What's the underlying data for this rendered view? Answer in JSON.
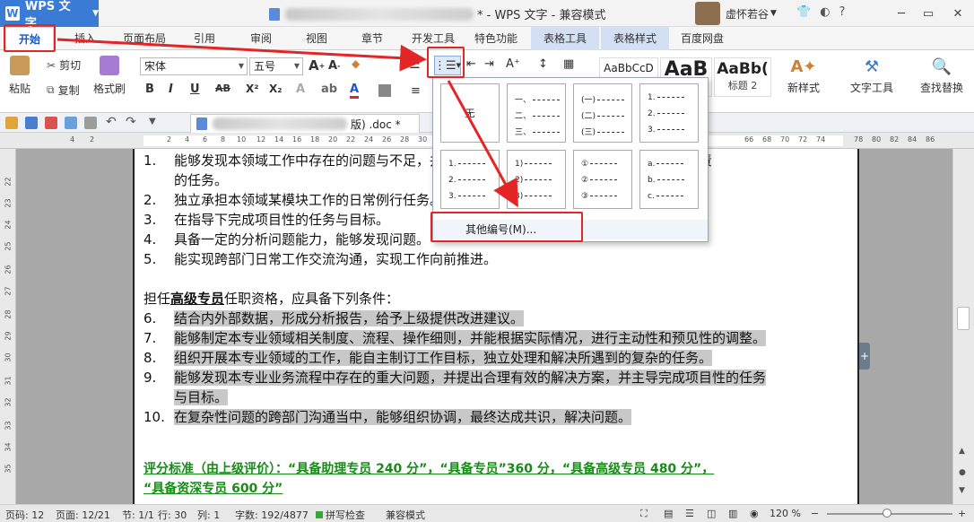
{
  "titlebar": {
    "app_button": "WPS 文字",
    "title": "* - WPS 文字 - 兼容模式",
    "user": "虚怀若谷"
  },
  "tabs": [
    "开始",
    "插入",
    "页面布局",
    "引用",
    "审阅",
    "视图",
    "章节",
    "开发工具",
    "特色功能",
    "表格工具",
    "表格样式",
    "百度网盘"
  ],
  "ribbon": {
    "paste": "粘贴",
    "cut": "剪切",
    "copy": "复制",
    "format_painter": "格式刷",
    "font_name": "宋体",
    "font_size": "五号",
    "style_normal": "AaBbCcD",
    "style_h1": "AaB",
    "style_h2": "AaBb(",
    "style_h2_label": "标题 2",
    "new_style": "新样式",
    "text_tools": "文字工具",
    "find_replace": "查找替换"
  },
  "quickbar": {
    "doc_tab": "版) .doc *"
  },
  "numbering_menu": {
    "none_label": "无",
    "styles": [
      [
        "一、",
        "二、",
        "三、"
      ],
      [
        "(一)",
        "(二)",
        "(三)"
      ],
      [
        "1.",
        "2.",
        "3."
      ],
      [
        "1.",
        "2.",
        "3."
      ],
      [
        "1)",
        "2)",
        "3)"
      ],
      [
        "①",
        "②",
        "③"
      ],
      [
        "a.",
        "b.",
        "c."
      ]
    ],
    "more": "其他编号(M)..."
  },
  "document": {
    "lines": [
      {
        "num": "1.",
        "text": "能够发现本领域工作中存在的问题与不足，并能针对性地提出改进建议，处理和解决所负责",
        "hl": false
      },
      {
        "num": "",
        "text": "的任务。",
        "hl": false
      },
      {
        "num": "2.",
        "text": "独立承担本领域某模块工作的日常例行任务。",
        "hl": false
      },
      {
        "num": "3.",
        "text": "在指导下完成项目性的任务与目标。",
        "hl": false
      },
      {
        "num": "4.",
        "text": "具备一定的分析问题能力，能够发现问题。",
        "hl": false
      },
      {
        "num": "5.",
        "text": "能实现跨部门日常工作交流沟通，实现工作向前推进。",
        "hl": false
      }
    ],
    "section_pre": "担任",
    "section_bold": "高级专员",
    "section_post": "任职资格，应具备下列条件：",
    "items": [
      {
        "num": "6.",
        "text": "结合内外部数据，形成分析报告，给予上级提供改进建议。"
      },
      {
        "num": "7.",
        "text": "能够制定本专业领域相关制度、流程、操作细则，并能根据实际情况，进行主动性和预见性的调整。"
      },
      {
        "num": "8.",
        "text": "组织开展本专业领域的工作，能自主制订工作目标，独立处理和解决所遇到的复杂的任务。"
      },
      {
        "num": "9.",
        "text": "能够发现本专业业务流程中存在的重大问题，并提出合理有效的解决方案，并主导完成项目性的任务"
      },
      {
        "num": "",
        "text": "与目标。"
      },
      {
        "num": "10.",
        "text": "在复杂性问题的跨部门沟通当中，能够组织协调，最终达成共识，解决问题。"
      }
    ],
    "green1": "评分标准（由上级评价）：“具备助理专员 240 分”，“具备专员”360 分，“具备高级专员 480 分”，",
    "green2": "“具备资深专员 600 分”"
  },
  "status": {
    "page_no": "页码: 12",
    "pages": "页面: 12/21",
    "section": "节: 1/1",
    "row": "行: 30",
    "col": "列: 1",
    "words": "字数: 192/4877",
    "spell": "拼写检查",
    "mode": "兼容模式",
    "zoom": "120 %"
  },
  "colors": {
    "accent": "#3a7bd5",
    "annotation": "#e42525",
    "green_text": "#1a8a1a"
  }
}
